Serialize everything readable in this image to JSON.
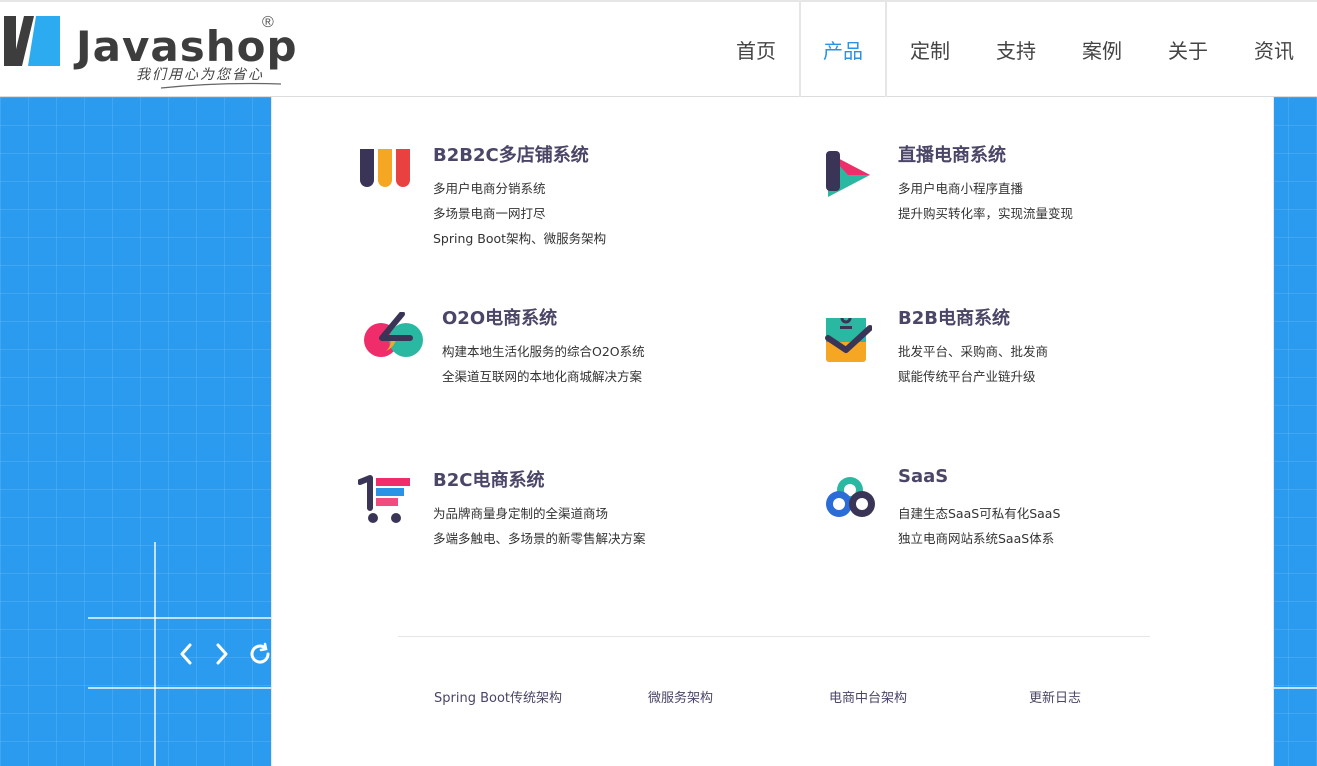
{
  "header": {
    "logo_text": "Javashop",
    "logo_registered": "®",
    "logo_slogan": "我们用心为您省心"
  },
  "nav": {
    "items": [
      {
        "label": "首页"
      },
      {
        "label": "产品",
        "active": true
      },
      {
        "label": "定制"
      },
      {
        "label": "支持"
      },
      {
        "label": "案例"
      },
      {
        "label": "关于"
      },
      {
        "label": "资讯"
      }
    ]
  },
  "products": [
    {
      "title": "B2B2C多店铺系统",
      "icon": "bars-icon",
      "lines": [
        "多用户电商分销系统",
        "多场景电商一网打尽",
        "Spring Boot架构、微服务架构"
      ]
    },
    {
      "title": "直播电商系统",
      "icon": "play-icon",
      "lines": [
        "多用户电商小程序直播",
        "提升购买转化率，实现流量变现"
      ]
    },
    {
      "title": "O2O电商系统",
      "icon": "o2o-icon",
      "lines": [
        "构建本地生活化服务的综合O2O系统",
        "全渠道互联网的本地化商城解决方案"
      ]
    },
    {
      "title": "B2B电商系统",
      "icon": "bag-check-icon",
      "lines": [
        "批发平台、采购商、批发商",
        "赋能传统平台产业链升级"
      ]
    },
    {
      "title": "B2C电商系统",
      "icon": "cart-icon",
      "lines": [
        "为品牌商量身定制的全渠道商场",
        "多端多触电、多场景的新零售解决方案"
      ]
    },
    {
      "title": "SaaS",
      "icon": "cloud-icon",
      "lines": [
        "自建生态SaaS可私有化SaaS",
        "独立电商网站系统SaaS体系"
      ]
    }
  ],
  "footer_links": [
    {
      "label": "Spring Boot传统架构"
    },
    {
      "label": "微服务架构"
    },
    {
      "label": "电商中台架构"
    },
    {
      "label": "更新日志"
    }
  ],
  "slider": {
    "prev": "‹",
    "next": "›"
  },
  "colors": {
    "accent": "#2b93e6",
    "background_blue": "#2b9bef",
    "title": "#4b4567"
  }
}
